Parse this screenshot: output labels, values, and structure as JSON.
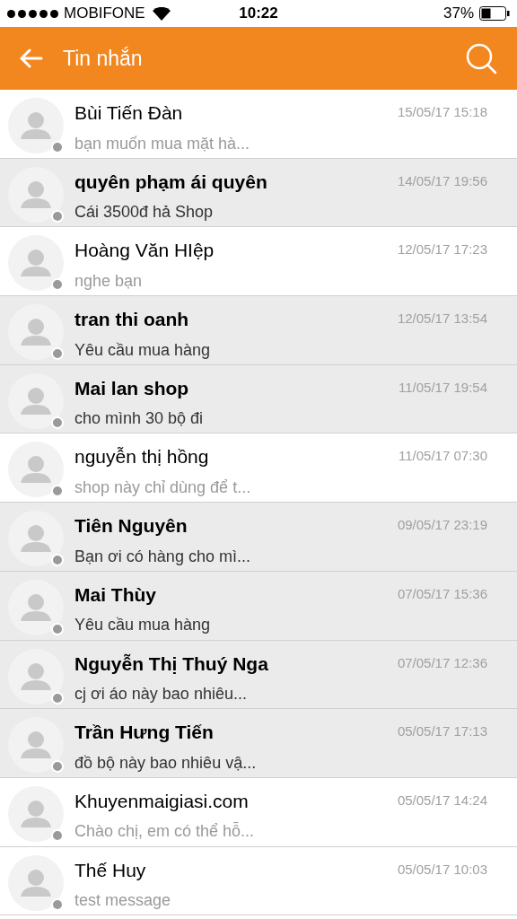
{
  "status_bar": {
    "carrier": "MOBIFONE",
    "time": "10:22",
    "battery": "37%"
  },
  "header": {
    "title": "Tin nhắn"
  },
  "conversations": [
    {
      "name": "Bùi Tiến Đàn",
      "preview": "bạn muốn mua mặt hà...",
      "time": "15/05/17 15:18",
      "unread": false
    },
    {
      "name": "quyên phạm ái quyên",
      "preview": "Cái 3500đ hả Shop",
      "time": "14/05/17 19:56",
      "unread": true
    },
    {
      "name": "Hoàng Văn HIệp",
      "preview": "nghe bạn",
      "time": "12/05/17 17:23",
      "unread": false
    },
    {
      "name": "tran thi oanh",
      "preview": "Yêu cầu mua hàng",
      "time": "12/05/17 13:54",
      "unread": true
    },
    {
      "name": "Mai lan shop",
      "preview": "cho mình 30 bộ đi",
      "time": "11/05/17 19:54",
      "unread": true
    },
    {
      "name": "nguyễn thị hồng",
      "preview": "shop này chỉ dùng để t...",
      "time": "11/05/17 07:30",
      "unread": false
    },
    {
      "name": "Tiên Nguyên",
      "preview": "Bạn ơi có hàng cho mì...",
      "time": "09/05/17 23:19",
      "unread": true
    },
    {
      "name": "Mai Thùy",
      "preview": "Yêu cầu mua hàng",
      "time": "07/05/17 15:36",
      "unread": true
    },
    {
      "name": "Nguyễn Thị Thuý Nga",
      "preview": "cj ơi áo này bao nhiêu...",
      "time": "07/05/17 12:36",
      "unread": true
    },
    {
      "name": "Trần Hưng Tiến",
      "preview": "đồ bộ này bao nhiêu vậ...",
      "time": "05/05/17 17:13",
      "unread": true
    },
    {
      "name": "Khuyenmaigiasi.com",
      "preview": "Chào chị, em có thể hỗ...",
      "time": "05/05/17 14:24",
      "unread": false
    },
    {
      "name": "Thế Huy",
      "preview": "test message",
      "time": "05/05/17 10:03",
      "unread": false
    }
  ]
}
